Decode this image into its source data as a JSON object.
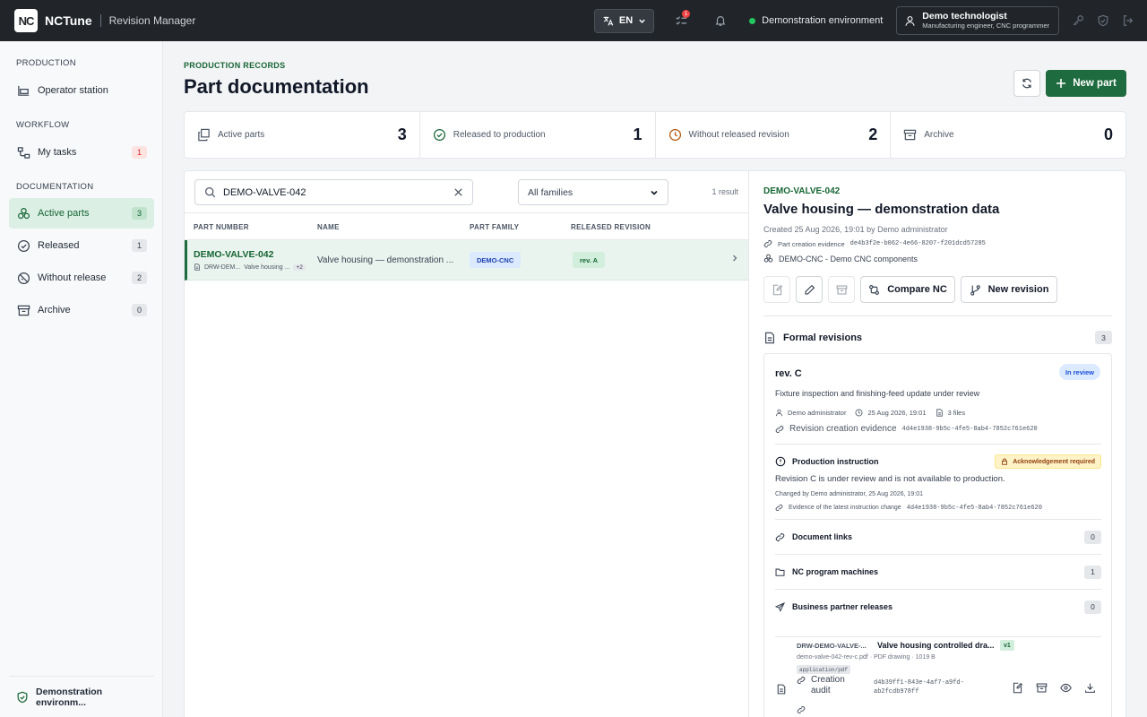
{
  "app": {
    "logo_text": "NC",
    "brand": "NCTune",
    "subtitle": "Revision Manager"
  },
  "topbar": {
    "language": "EN",
    "tasks_badge": "1",
    "environment": "Demonstration environment",
    "user_name": "Demo technologist",
    "user_role": "Manufacturing engineer, CNC programmer"
  },
  "sidebar": {
    "sections": [
      {
        "title": "PRODUCTION",
        "items": [
          {
            "label": "Operator station",
            "count": ""
          }
        ]
      },
      {
        "title": "WORKFLOW",
        "items": [
          {
            "label": "My tasks",
            "count": "1"
          }
        ]
      },
      {
        "title": "DOCUMENTATION",
        "items": [
          {
            "label": "Active parts",
            "count": "3"
          },
          {
            "label": "Released",
            "count": "1"
          },
          {
            "label": "Without release",
            "count": "2"
          },
          {
            "label": "Archive",
            "count": "0"
          }
        ]
      }
    ],
    "footer": "Demonstration environm..."
  },
  "header": {
    "eyebrow": "PRODUCTION RECORDS",
    "title": "Part documentation",
    "new_part": "New part"
  },
  "stats": [
    {
      "label": "Active parts",
      "value": "3"
    },
    {
      "label": "Released to production",
      "value": "1"
    },
    {
      "label": "Without released revision",
      "value": "2"
    },
    {
      "label": "Archive",
      "value": "0"
    }
  ],
  "list": {
    "search_value": "DEMO-VALVE-042",
    "family_filter": "All families",
    "result_count": "1 result",
    "columns": [
      "PART NUMBER",
      "NAME",
      "PART FAMILY",
      "RELEASED REVISION"
    ],
    "rows": [
      {
        "part_number": "DEMO-VALVE-042",
        "drawing": "DRW-DEM...",
        "drawing_name": "Valve housing ...",
        "extra": "+2",
        "name": "Valve housing — demonstration ...",
        "family": "DEMO-CNC",
        "revision": "rev. A"
      }
    ]
  },
  "detail": {
    "code": "DEMO-VALVE-042",
    "title": "Valve housing — demonstration data",
    "created": "Created 25 Aug 2026, 19:01 by Demo administrator",
    "evidence_label": "Part creation evidence",
    "evidence_hash": "de4b3f2e-b062-4e66-8207-f201dcd57285",
    "family": "DEMO-CNC - Demo CNC components",
    "compare_nc": "Compare NC",
    "new_revision": "New revision",
    "formal_revisions": "Formal revisions",
    "formal_revisions_count": "3",
    "revision": {
      "name": "rev. C",
      "status": "In review",
      "description": "Fixture inspection and finishing-feed update under review",
      "author": "Demo administrator",
      "date": "25 Aug 2026, 19:01",
      "files": "3 files",
      "evidence_label": "Revision creation evidence",
      "evidence_hash": "4d4e1938-9b5c-4fe5-8ab4-7852c761e620"
    },
    "instruction": {
      "title": "Production instruction",
      "badge": "Acknowledgement required",
      "text": "Revision C is under review and is not available to production.",
      "changed": "Changed by Demo administrator, 25 Aug 2026, 19:01",
      "evidence_label": "Evidence of the latest instruction change",
      "evidence_hash": "4d4e1938-9b5c-4fe5-8ab4-7852c761e620"
    },
    "sections": [
      {
        "label": "Document links",
        "count": "0"
      },
      {
        "label": "NC program machines",
        "count": "1"
      },
      {
        "label": "Business partner releases",
        "count": "0"
      }
    ],
    "document": {
      "code": "DRW-DEMO-VALVE-...",
      "title": "Valve housing controlled dra...",
      "version": "v1",
      "file": "demo-valve-042-rev-c.pdf · PDF drawing · 1019 B",
      "mime": "application/pdf",
      "audit_label": "Creation audit",
      "audit_hash": "d4b39ff1-843e-4af7-a9fd-ab2fcdb978ff"
    }
  }
}
